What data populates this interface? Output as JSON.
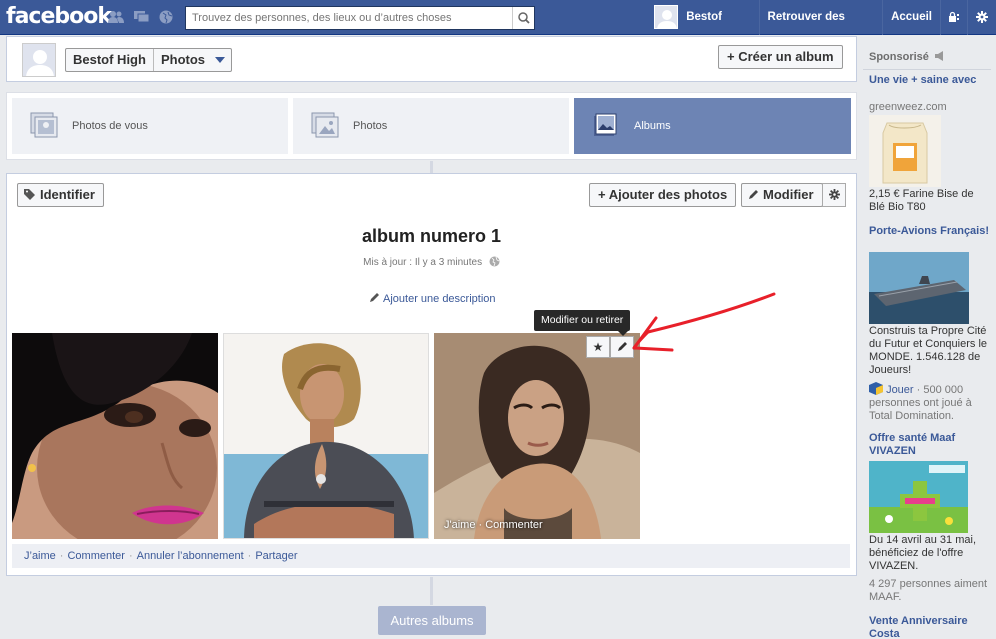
{
  "topbar": {
    "logo": "facebook",
    "search_placeholder": "Trouvez des personnes, des lieux ou d’autres choses",
    "user_name": "Bestof High",
    "find_friends": "Retrouver des amis",
    "home": "Accueil"
  },
  "profile_header": {
    "name": "Bestof High",
    "section": "Photos",
    "create_album": "+ Créer un album"
  },
  "tabs": [
    {
      "label": "Photos de vous",
      "active": false
    },
    {
      "label": "Photos",
      "active": false
    },
    {
      "label": "Albums",
      "active": true
    }
  ],
  "album": {
    "tag_button": "Identifier",
    "add_photos": "+ Ajouter des photos",
    "edit": "Modifier",
    "title": "album numero 1",
    "updated": "Mis à jour : Il y a 3 minutes",
    "add_description": "Ajouter une description",
    "tooltip": "Modifier ou retirer",
    "photo_overlay": "J'aime · Commenter",
    "actions": [
      "J’aime",
      "Commenter",
      "Annuler l’abonnement",
      "Partager"
    ],
    "other_albums": "Autres albums"
  },
  "sidebar": {
    "sponsored": "Sponsorisé",
    "ads": [
      {
        "title": "Une vie + saine avec",
        "domain": "greenweez.com",
        "text": "2,15 € Farine Bise de Blé Bio T80"
      },
      {
        "title": "Porte-Avions Français!",
        "text": "Construis ta Propre Cité du Futur et Conquiers le MONDE. 1.546.128 de Joueurs!",
        "like": "Jouer",
        "social": "· 500 000 personnes ont joué à Total Domination."
      },
      {
        "title": "Offre santé Maaf VIVAZEN",
        "text": "Du 14 avril au 31 mai, bénéficiez de l'offre VIVAZEN.",
        "social": "4 297 personnes aiment MAAF."
      },
      {
        "title": "Vente Anniversaire Costa"
      }
    ]
  },
  "colors": {
    "brand": "#3b5998",
    "active_tab": "#6d84b4",
    "annotation_arrow": "#e8202a"
  }
}
